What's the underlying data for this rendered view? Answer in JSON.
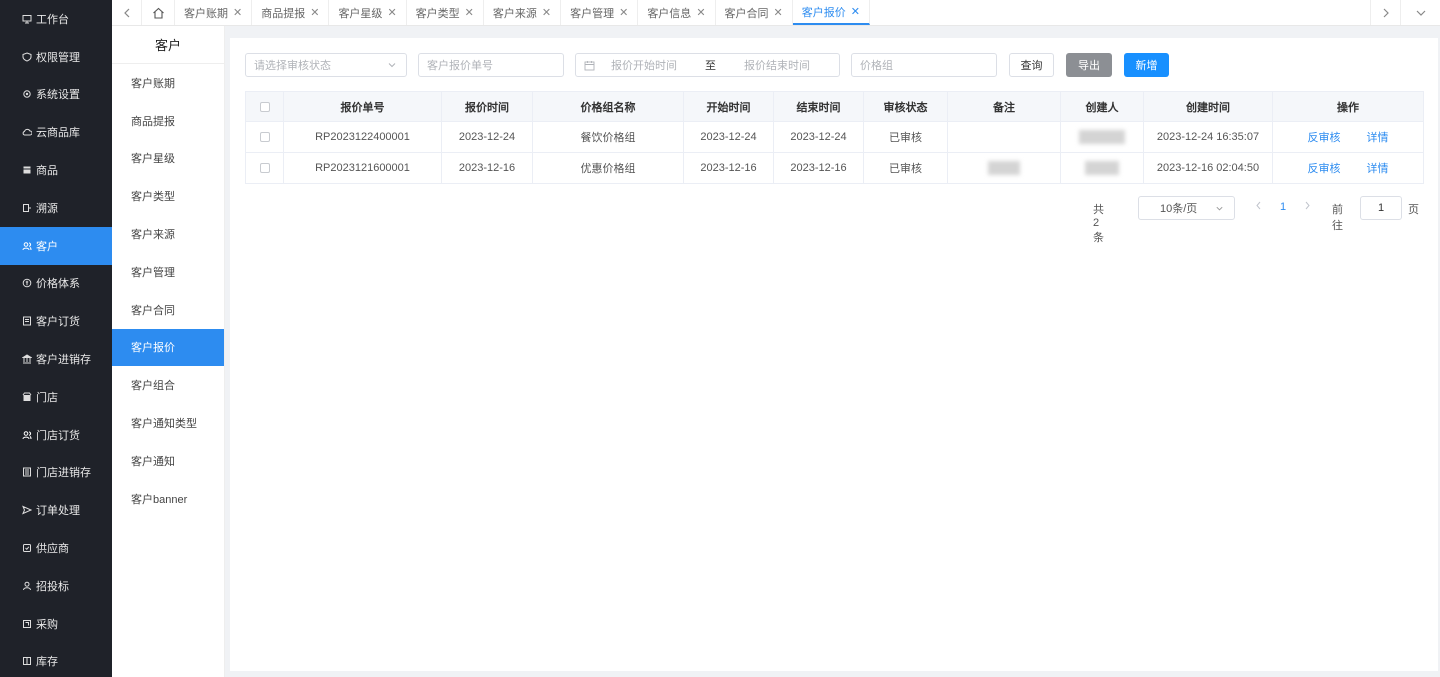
{
  "sidebar": {
    "items": [
      {
        "label": "工作台",
        "icon": "monitor-icon"
      },
      {
        "label": "权限管理",
        "icon": "shield-icon"
      },
      {
        "label": "系统设置",
        "icon": "gear-icon"
      },
      {
        "label": "云商品库",
        "icon": "cloud-icon"
      },
      {
        "label": "商品",
        "icon": "box-icon"
      },
      {
        "label": "溯源",
        "icon": "trace-icon"
      },
      {
        "label": "客户",
        "icon": "users-icon"
      },
      {
        "label": "价格体系",
        "icon": "price-icon"
      },
      {
        "label": "客户订货",
        "icon": "order-icon"
      },
      {
        "label": "客户进销存",
        "icon": "bank-icon"
      },
      {
        "label": "门店",
        "icon": "store-icon"
      },
      {
        "label": "门店订货",
        "icon": "users-icon"
      },
      {
        "label": "门店进销存",
        "icon": "ledger-icon"
      },
      {
        "label": "订单处理",
        "icon": "send-icon"
      },
      {
        "label": "供应商",
        "icon": "supplier-icon"
      },
      {
        "label": "招投标",
        "icon": "user-icon"
      },
      {
        "label": "采购",
        "icon": "purchase-icon"
      },
      {
        "label": "库存",
        "icon": "stock-icon"
      }
    ],
    "active_index": 6
  },
  "tabs": {
    "items": [
      "客户账期",
      "商品提报",
      "客户星级",
      "客户类型",
      "客户来源",
      "客户管理",
      "客户信息",
      "客户合同",
      "客户报价"
    ],
    "active_index": 8,
    "close_glyph": "✕"
  },
  "subnav": {
    "title": "客户",
    "items": [
      "客户账期",
      "商品提报",
      "客户星级",
      "客户类型",
      "客户来源",
      "客户管理",
      "客户合同",
      "客户报价",
      "客户组合",
      "客户通知类型",
      "客户通知",
      "客户banner"
    ],
    "active_index": 7
  },
  "filters": {
    "status_placeholder": "请选择审核状态",
    "quote_no_placeholder": "客户报价单号",
    "start_placeholder": "报价开始时间",
    "range_sep": "至",
    "end_placeholder": "报价结束时间",
    "price_group_placeholder": "价格组",
    "query_label": "查询",
    "export_label": "导出",
    "add_label": "新增"
  },
  "table": {
    "headers": [
      "报价单号",
      "报价时间",
      "价格组名称",
      "开始时间",
      "结束时间",
      "审核状态",
      "备注",
      "创建人",
      "创建时间",
      "操作"
    ],
    "rows": [
      {
        "no": "RP2023122400001",
        "quote_time": "2023-12-24",
        "group": "餐饮价格组",
        "start": "2023-12-24",
        "end": "2023-12-24",
        "status": "已审核",
        "remark": "",
        "creator": "",
        "created": "2023-12-24 16:35:07"
      },
      {
        "no": "RP2023121600001",
        "quote_time": "2023-12-16",
        "group": "优惠价格组",
        "start": "2023-12-16",
        "end": "2023-12-16",
        "status": "已审核",
        "remark": "",
        "creator": "",
        "created": "2023-12-16 02:04:50"
      }
    ],
    "action_unaudit": "反审核",
    "action_detail": "详情"
  },
  "pagination": {
    "total": "共 2 条",
    "page_size": "10条/页",
    "current": "1",
    "goto_label": "前往",
    "goto_value": "1",
    "page_suffix": "页"
  },
  "colors": {
    "accent": "#2d8cf0",
    "sidebar_bg": "#1f2229"
  }
}
